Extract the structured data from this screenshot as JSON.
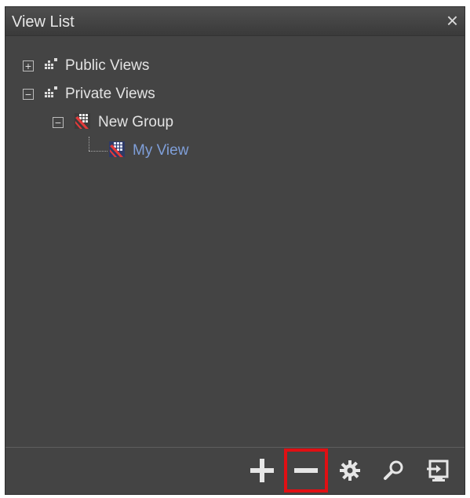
{
  "window": {
    "title": "View List",
    "close_glyph": "×"
  },
  "tree": {
    "public": {
      "label": "Public Views",
      "toggle": "+"
    },
    "private": {
      "label": "Private Views",
      "toggle": "−"
    },
    "group": {
      "label": "New Group",
      "toggle": "−"
    },
    "view": {
      "label": "My View"
    }
  },
  "colors": {
    "background": "#444444",
    "text": "#e3e3e3",
    "selected_text": "#7f9fd9",
    "highlight": "#e10f13"
  },
  "toolbar": {
    "buttons": [
      {
        "name": "add-button",
        "icon": "plus-icon"
      },
      {
        "name": "remove-button",
        "icon": "minus-icon",
        "highlighted": true
      },
      {
        "name": "settings-button",
        "icon": "gear-icon"
      },
      {
        "name": "search-button",
        "icon": "search-icon"
      },
      {
        "name": "export-button",
        "icon": "export-icon"
      }
    ]
  }
}
